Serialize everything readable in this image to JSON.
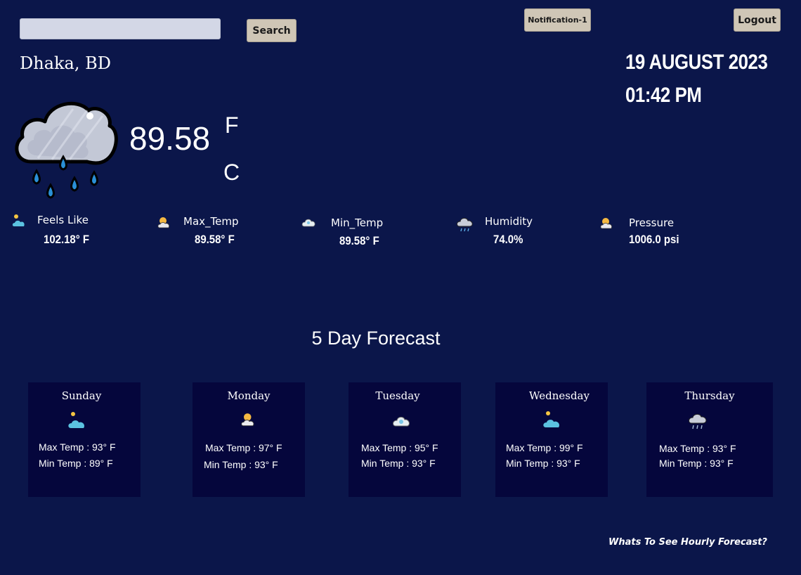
{
  "header": {
    "search_placeholder": "",
    "search_label": "Search",
    "notification_label": "Notification-1",
    "logout_label": "Logout"
  },
  "location": {
    "city": "Dhaka, BD"
  },
  "datetime": {
    "date": "19 AUGUST 2023",
    "time": "01:42 PM"
  },
  "current": {
    "icon": "rain-cloud-icon",
    "temperature": "89.58",
    "unit_f": "F",
    "unit_c": "C"
  },
  "stats": [
    {
      "label": "Feels Like",
      "value": "102.18° F",
      "icon": "partly-sunny-icon"
    },
    {
      "label": "Max_Temp",
      "value": "89.58° F",
      "icon": "sun-cloud-icon"
    },
    {
      "label": "Min_Temp",
      "value": "89.58° F",
      "icon": "cloud-icon"
    },
    {
      "label": "Humidity",
      "value": "74.0%",
      "icon": "rain-cloud-icon"
    },
    {
      "label": "Pressure",
      "value": "1006.0 psi",
      "icon": "sun-cloud-icon"
    }
  ],
  "forecast": {
    "title": "5 Day Forecast",
    "days": [
      {
        "day": "Sunday",
        "max": "Max Temp : 93° F",
        "min": "Min Temp : 89° F",
        "icon": "partly-sunny-icon"
      },
      {
        "day": "Monday",
        "max": "Max Temp : 97° F",
        "min": "Min Temp : 93° F",
        "icon": "sun-cloud-icon"
      },
      {
        "day": "Tuesday",
        "max": "Max Temp : 95° F",
        "min": "Min Temp : 93° F",
        "icon": "cloud-icon"
      },
      {
        "day": "Wednesday",
        "max": "Max Temp : 99° F",
        "min": "Min Temp : 93° F",
        "icon": "partly-sunny-icon"
      },
      {
        "day": "Thursday",
        "max": "Max Temp : 93° F",
        "min": "Min Temp : 93° F",
        "icon": "rain-cloud-icon"
      }
    ]
  },
  "hourly_link": "Whats To See Hourly Forecast?",
  "colors": {
    "background": "#0b164a",
    "card": "#05063c",
    "button": "#cfc6b6"
  }
}
